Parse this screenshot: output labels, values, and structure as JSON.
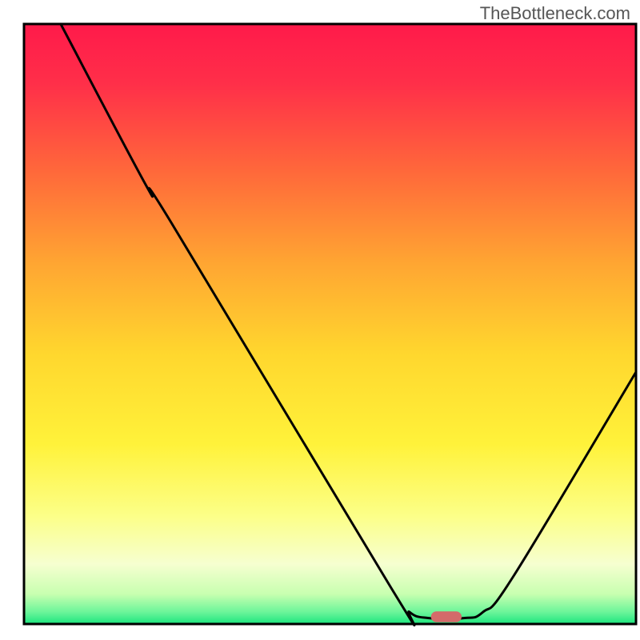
{
  "watermark": "TheBottleneck.com",
  "chart_data": {
    "type": "line",
    "title": "",
    "xlabel": "",
    "ylabel": "",
    "xlim": [
      0,
      100
    ],
    "ylim": [
      0,
      100
    ],
    "background_gradient": {
      "stops": [
        {
          "offset": 0,
          "color": "#ff1a4a"
        },
        {
          "offset": 10,
          "color": "#ff2f49"
        },
        {
          "offset": 25,
          "color": "#ff6a3a"
        },
        {
          "offset": 40,
          "color": "#ffa632"
        },
        {
          "offset": 55,
          "color": "#ffd72e"
        },
        {
          "offset": 70,
          "color": "#fff23a"
        },
        {
          "offset": 82,
          "color": "#fcff88"
        },
        {
          "offset": 90,
          "color": "#f6ffd0"
        },
        {
          "offset": 95,
          "color": "#c8ffb0"
        },
        {
          "offset": 98,
          "color": "#6cf59a"
        },
        {
          "offset": 100,
          "color": "#1be57e"
        }
      ]
    },
    "series": [
      {
        "name": "bottleneck-curve",
        "color": "#000000",
        "points": [
          {
            "x": 6,
            "y": 100
          },
          {
            "x": 20,
            "y": 73
          },
          {
            "x": 24,
            "y": 67
          },
          {
            "x": 60,
            "y": 6
          },
          {
            "x": 63,
            "y": 2
          },
          {
            "x": 66,
            "y": 1
          },
          {
            "x": 72,
            "y": 1
          },
          {
            "x": 75,
            "y": 2
          },
          {
            "x": 80,
            "y": 8
          },
          {
            "x": 100,
            "y": 42
          }
        ]
      }
    ],
    "marker": {
      "name": "optimal-pill",
      "x": 69,
      "y": 1.2,
      "width": 5,
      "height": 1.8,
      "color": "#d46a6a"
    },
    "plot_border_color": "#000000",
    "plot_border_width": 3
  }
}
